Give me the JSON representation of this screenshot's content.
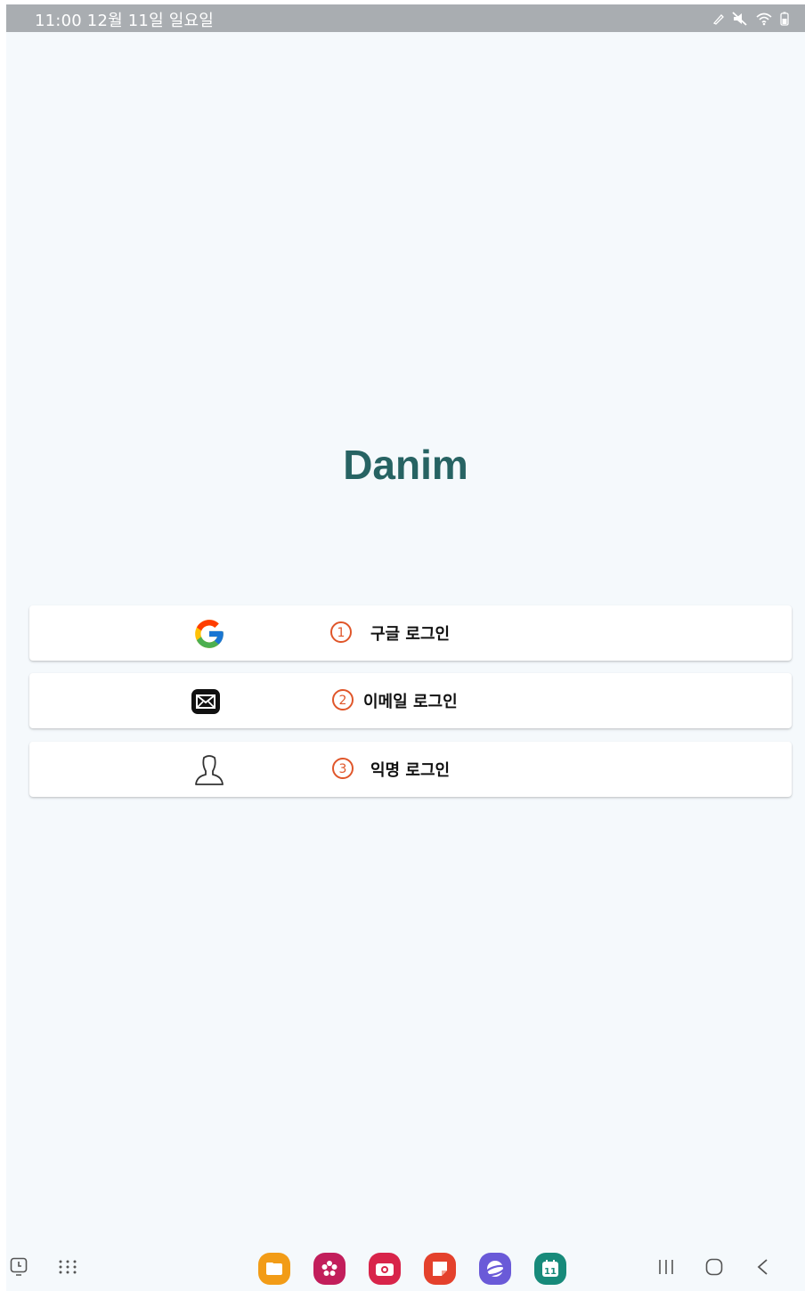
{
  "status_bar": {
    "time_date": "11:00  12월 11일 일요일",
    "icons": [
      "pen-icon",
      "mute-icon",
      "wifi-icon",
      "battery-icon"
    ]
  },
  "app": {
    "title": "Danim",
    "title_color": "#276363"
  },
  "login_options": [
    {
      "number": "1",
      "label": "구글 로그인",
      "icon": "google-icon"
    },
    {
      "number": "2",
      "label": "이메일 로그인",
      "icon": "mail-icon"
    },
    {
      "number": "3",
      "label": "익명 로그인",
      "icon": "person-icon"
    }
  ],
  "annotation_color": "#e0562a",
  "taskbar": {
    "left": [
      "screen-recorder-icon",
      "app-drawer-icon"
    ],
    "apps": [
      {
        "name": "my-files-app-icon",
        "color": "#f29c17"
      },
      {
        "name": "bixby-app-icon",
        "color": "#c21e5b"
      },
      {
        "name": "camera-app-icon",
        "color": "#d8244a"
      },
      {
        "name": "notes-app-icon",
        "color": "#e4412c"
      },
      {
        "name": "internet-app-icon",
        "color": "#6a5ad8"
      },
      {
        "name": "calendar-app-icon",
        "color": "#178a7a",
        "text": "11"
      }
    ],
    "nav": [
      "recent-apps-icon",
      "home-icon",
      "back-icon"
    ]
  }
}
